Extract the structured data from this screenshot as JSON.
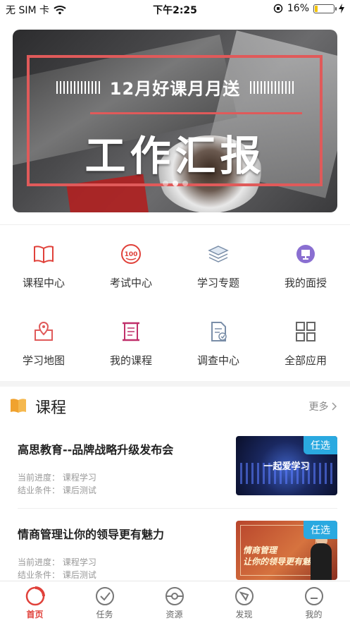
{
  "status_bar": {
    "carrier": "无 SIM 卡",
    "time": "下午2:25",
    "battery_percent_text": "16%",
    "battery_level": 0.16
  },
  "banner": {
    "subtitle": "12月好课月月送",
    "title": "工作汇报"
  },
  "shortcuts": [
    {
      "label": "课程中心",
      "icon": "book-open-icon"
    },
    {
      "label": "考试中心",
      "icon": "exam-100-icon"
    },
    {
      "label": "学习专题",
      "icon": "layers-icon"
    },
    {
      "label": "我的面授",
      "icon": "classroom-icon"
    },
    {
      "label": "学习地图",
      "icon": "map-pin-icon"
    },
    {
      "label": "我的课程",
      "icon": "scroll-icon"
    },
    {
      "label": "调查中心",
      "icon": "survey-icon"
    },
    {
      "label": "全部应用",
      "icon": "grid-icon"
    }
  ],
  "courses_section": {
    "title": "课程",
    "more": "更多"
  },
  "courses": [
    {
      "name": "高思教育--品牌战略升级发布会",
      "progress_label": "当前进度：",
      "progress_value": "课程学习",
      "completion_label": "结业条件：",
      "completion_value": "课后测试",
      "tag": "任选",
      "thumb_text": "一起爱学习"
    },
    {
      "name": "情商管理让你的领导更有魅力",
      "progress_label": "当前进度：",
      "progress_value": "课程学习",
      "completion_label": "结业条件：",
      "completion_value": "课后测试",
      "tag": "任选",
      "thumb_text_1": "情商管理",
      "thumb_text_2": "让你的领导更有魅力"
    }
  ],
  "tabbar": {
    "items": [
      {
        "label": "首页",
        "icon": "home-ring-icon",
        "active": true
      },
      {
        "label": "任务",
        "icon": "clock-check-icon",
        "active": false
      },
      {
        "label": "资源",
        "icon": "pokeball-icon",
        "active": false
      },
      {
        "label": "发现",
        "icon": "compass-icon",
        "active": false
      },
      {
        "label": "我的",
        "icon": "profile-icon",
        "active": false
      }
    ]
  },
  "colors": {
    "accent": "#e0413a",
    "tag_blue": "#2aa9e0",
    "icon_orange": "#f0a22e"
  }
}
